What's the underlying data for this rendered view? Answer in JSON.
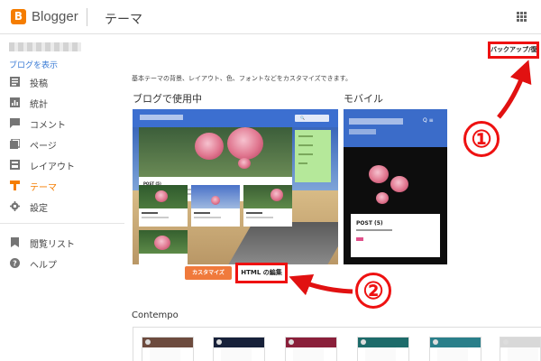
{
  "header": {
    "logo_letter": "B",
    "brand": "Blogger",
    "title": "テーマ",
    "apps_icon": "apps-grid-icon"
  },
  "sidebar": {
    "view_blog": "ブログを表示",
    "items": [
      {
        "label": "投稿",
        "icon": "posts-icon"
      },
      {
        "label": "統計",
        "icon": "stats-icon"
      },
      {
        "label": "コメント",
        "icon": "comments-icon"
      },
      {
        "label": "ページ",
        "icon": "pages-icon"
      },
      {
        "label": "レイアウト",
        "icon": "layout-icon"
      },
      {
        "label": "テーマ",
        "icon": "theme-icon",
        "active": true
      },
      {
        "label": "設定",
        "icon": "gear-icon"
      },
      {
        "label": "閲覧リスト",
        "icon": "bookmark-icon"
      },
      {
        "label": "ヘルプ",
        "icon": "help-icon"
      }
    ]
  },
  "main": {
    "backup_button": "バックアップ/復元",
    "description": "基本テーマの背景、レイアウト、色、フォントなどをカスタマイズできます。",
    "desktop_label": "ブログで使用中",
    "mobile_label": "モバイル",
    "customize_button": "カスタマイズ",
    "edit_html_button": "HTML の編集",
    "contempo_label": "Contempo"
  },
  "preview": {
    "desktop_post_title": "POST (5)",
    "mobile_post_title": "POST (5)",
    "mobile_icons": "Q ≡"
  },
  "annotations": {
    "circle1": "①",
    "circle2": "②",
    "color": "#e11111"
  },
  "colors": {
    "accent": "#f57d00",
    "link": "#3a7bd5",
    "header_blue": "#3c6fd0"
  }
}
